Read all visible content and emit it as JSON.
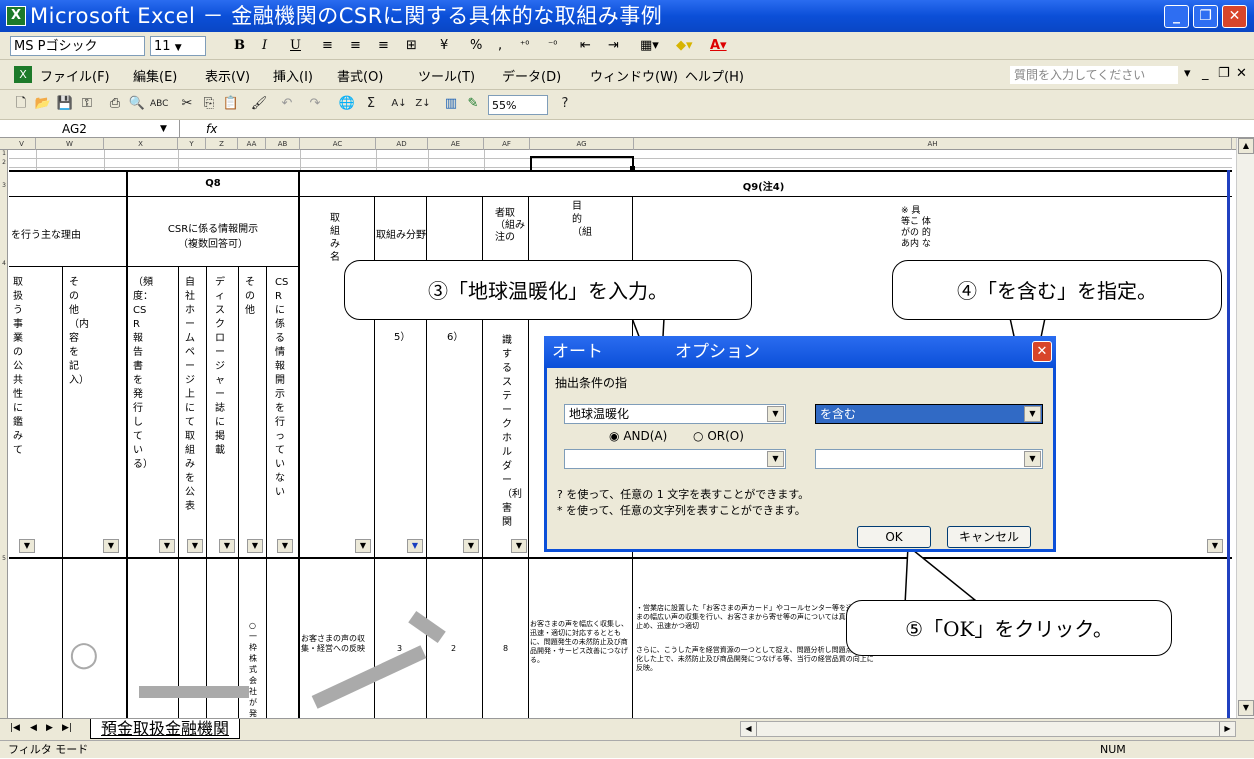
{
  "window": {
    "title": "Microsoft Excel － 金融機関のCSRに関する具体的な取組み事例",
    "icon": "excel-icon"
  },
  "format_toolbar": {
    "font": "MS Pゴシック",
    "size": "11",
    "bold": "B",
    "italic": "I",
    "underline": "U",
    "percent": "%",
    "comma": ","
  },
  "menu": [
    "ファイル(F)",
    "編集(E)",
    "表示(V)",
    "挿入(I)",
    "書式(O)",
    "ツール(T)",
    "データ(D)",
    "ウィンドウ(W)",
    "ヘルプ(H)"
  ],
  "help_placeholder": "質問を入力してください",
  "std_toolbar": {
    "zoom": "55%"
  },
  "formula": {
    "name_box": "AG2",
    "fx": "fx"
  },
  "columns": [
    "V",
    "W",
    "X",
    "Y",
    "Z",
    "AA",
    "AB",
    "AC",
    "AD",
    "AE",
    "AF",
    "AG",
    "AH"
  ],
  "rows": [
    "1",
    "2",
    "3",
    "4",
    "5",
    "6"
  ],
  "sheet": {
    "q8": "Q8",
    "q9": "Q9(注4)",
    "reason_header": "を行う主な理由",
    "disclosure_header": "CSRに係る情報開示\n（複数回答可）",
    "torikumi_mei": "取組み名",
    "torikumi_bunya": "取組み分野",
    "v_col1": "取扱う事業の公共性に鑑みて",
    "v_col2": "その他（内容を記入）",
    "v_col3": "（頻度：CSR報告書を発行している）",
    "v_col4": "自社ホームページ上にて取組みを公表",
    "v_col5": "ディスクロージャー誌に掲載",
    "v_col6": "その他",
    "v_col7": "CSRに係る情報開示を行っていない",
    "ad_val": "5）",
    "ae_val": "6）",
    "af_text": "識するステークホルダー（利害関",
    "ag_head": "目的（組",
    "af_head": "者取（組み注の",
    "ah_head": "※ 具\n等こ 体\nがの 的\nあ内 な",
    "r6_o": "○",
    "r6_aa": "○一枠株式会社が発行",
    "r6_ac": "お客さまの声の収集・経営への反映",
    "r6_ad": "3",
    "r6_ae": "2",
    "r6_af": "8",
    "r6_ag": "お客さまの声を幅広く収集し、迅速・適切に対応するとともに、問題発生の未然防止及び商品開発・サービス改善につなげる。",
    "r6_ah1": "・営業店に設置した「お客さまの声カード」やコールセンター等を通じてさまの幅広い声の収集を行い、お客さまから寄せ等の声については真摯に受け止め、迅速かつ適切",
    "r6_ah2": "さらに、こうした声を経営資源の一つとして捉え、問題分析し問題点を明確化した上で、未然防止及び商品開発につなげる等、当行の経営品質の向上に反映。"
  },
  "callouts": {
    "c3": "③「地球温暖化」を入力。",
    "c4": "④「を含む」を指定。",
    "c5": "⑤「OK」をクリック。"
  },
  "dialog": {
    "title": "オートフィルタ オプション",
    "title_visible1": "オート",
    "title_visible2": "オプション",
    "label": "抽出条件の指",
    "value1": "地球温暖化",
    "op1": "を含む",
    "and_label": "AND(A)",
    "or_label": "OR(O)",
    "value2": "",
    "op2": "",
    "hint1": "? を使って、任意の 1 文字を表すことができます。",
    "hint2": "* を使って、任意の文字列を表すことができます。",
    "ok": "OK",
    "cancel": "キャンセル"
  },
  "tabs": {
    "active": "預金取扱金融機関"
  },
  "status": {
    "mode": "フィルタ モード",
    "num": "NUM"
  }
}
